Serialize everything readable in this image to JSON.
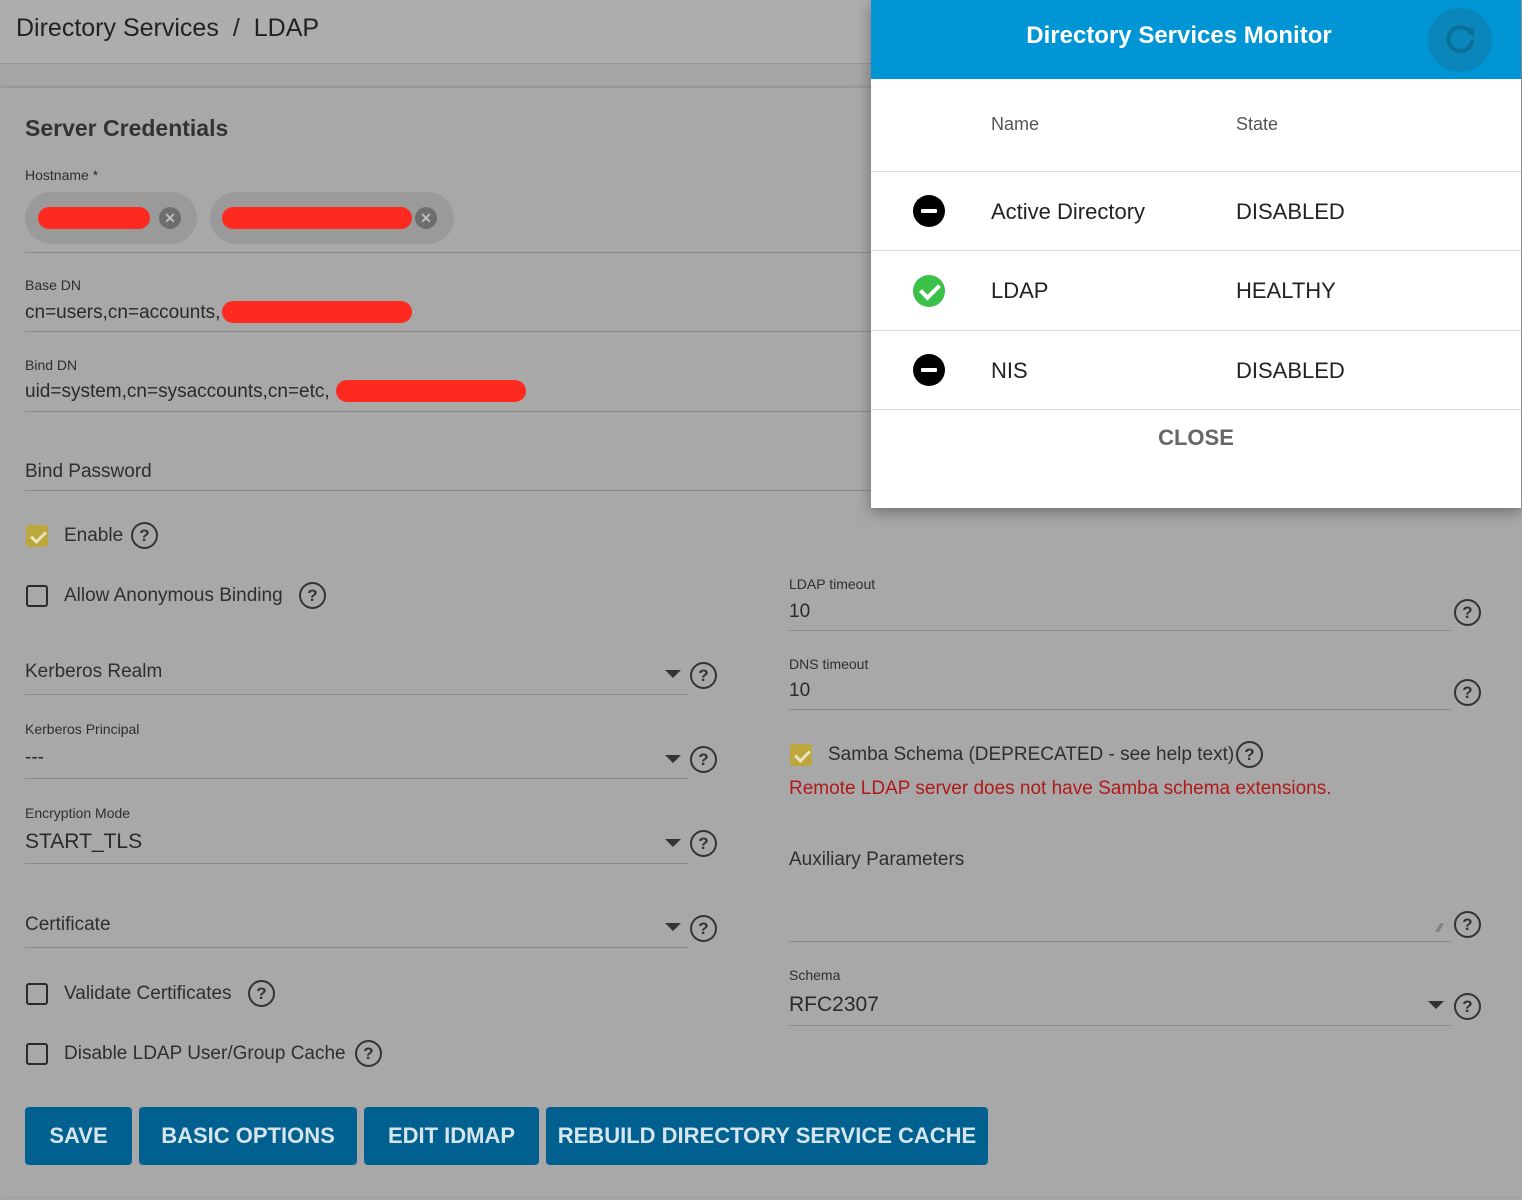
{
  "breadcrumb": {
    "parent": "Directory Services",
    "separator": "/",
    "current": "LDAP"
  },
  "section_title": "Server Credentials",
  "hostname": {
    "label": "Hostname *"
  },
  "base_dn": {
    "label": "Base DN",
    "value": "cn=users,cn=accounts,"
  },
  "bind_dn": {
    "label": "Bind DN",
    "value": "uid=system,cn=sysaccounts,cn=etc,"
  },
  "bind_password": {
    "placeholder": "Bind Password"
  },
  "enable": {
    "label": "Enable",
    "checked": true
  },
  "anon_binding": {
    "label": "Allow Anonymous Binding",
    "checked": false
  },
  "kerberos_realm": {
    "placeholder": "Kerberos Realm"
  },
  "kerberos_principal": {
    "label": "Kerberos Principal",
    "value": "---"
  },
  "encryption_mode": {
    "label": "Encryption Mode",
    "value": "START_TLS"
  },
  "certificate": {
    "placeholder": "Certificate"
  },
  "validate_certs": {
    "label": "Validate Certificates",
    "checked": false
  },
  "disable_cache": {
    "label": "Disable LDAP User/Group Cache",
    "checked": false
  },
  "ldap_timeout": {
    "label": "LDAP timeout",
    "value": "10"
  },
  "dns_timeout": {
    "label": "DNS timeout",
    "value": "10"
  },
  "samba_schema": {
    "label": "Samba Schema (DEPRECATED - see help text)",
    "checked": true,
    "error": "Remote LDAP server does not have Samba schema extensions."
  },
  "aux_params": {
    "placeholder": "Auxiliary Parameters"
  },
  "schema": {
    "label": "Schema",
    "value": "RFC2307"
  },
  "buttons": {
    "save": "SAVE",
    "basic_options": "BASIC OPTIONS",
    "edit_idmap": "EDIT IDMAP",
    "rebuild_cache": "REBUILD DIRECTORY SERVICE CACHE"
  },
  "monitor": {
    "title": "Directory Services Monitor",
    "col_name": "Name",
    "col_state": "State",
    "rows": [
      {
        "name": "Active Directory",
        "state": "DISABLED",
        "icon": "disabled-icon"
      },
      {
        "name": "LDAP",
        "state": "HEALTHY",
        "icon": "healthy-check-icon"
      },
      {
        "name": "NIS",
        "state": "DISABLED",
        "icon": "disabled-icon"
      }
    ],
    "close": "CLOSE"
  },
  "colors": {
    "accent": "#0095d4",
    "button": "#00608f",
    "error": "#b21919",
    "healthy": "#3bc14a",
    "redaction": "#ff2a1f"
  }
}
